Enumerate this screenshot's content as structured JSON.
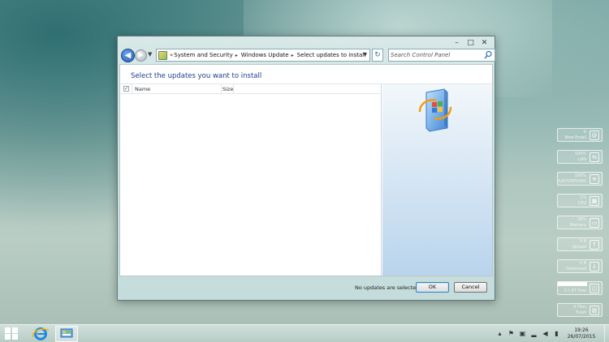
{
  "window": {
    "caption_buttons": {
      "minimize": "–",
      "maximize": "□",
      "close": "✕"
    },
    "address": {
      "lead": "«",
      "crumbs": [
        "System and Security",
        "Windows Update",
        "Select updates to install"
      ],
      "separator": "▸"
    },
    "search": {
      "placeholder": "Search Control Panel"
    },
    "page_title": "Select the updates you want to install",
    "list": {
      "columns": [
        "Name",
        "Size"
      ],
      "header_checkbox": "✓"
    },
    "footer": {
      "status": "No updates are selected.",
      "ok_label": "OK",
      "cancel_label": "Cancel"
    }
  },
  "gadgets": [
    {
      "value": "0",
      "label": "New Email",
      "icon": "mail-icon"
    },
    {
      "value": "100%",
      "label": "LAN",
      "icon": "network-icon"
    },
    {
      "value": "100%",
      "label": "PLAYSTATION3",
      "icon": "wifi-icon"
    },
    {
      "value": "1%",
      "label": "CPU",
      "icon": "cpu-icon"
    },
    {
      "value": "28%",
      "label": "Memory",
      "icon": "memory-icon"
    },
    {
      "value": "0 B",
      "label": "Upload",
      "icon": "upload-icon"
    },
    {
      "value": "0 B",
      "label": "Download",
      "icon": "download-icon"
    },
    {
      "value": "",
      "label": "C:\\ 47 Free",
      "icon": "disk-icon"
    },
    {
      "value": "0 Files",
      "label": "Trash",
      "icon": "trash-icon"
    }
  ],
  "taskbar": {
    "apps": [
      "internet-explorer-icon",
      "control-panel-icon"
    ],
    "tray_icons": [
      "chevron-up-icon",
      "flag-icon",
      "network-icon",
      "volume-icon",
      "battery-icon"
    ],
    "time": "19:26",
    "date": "26/07/2015"
  },
  "colors": {
    "title_blue": "#1e3d8f",
    "nav_blue": "#1f5cb3"
  }
}
